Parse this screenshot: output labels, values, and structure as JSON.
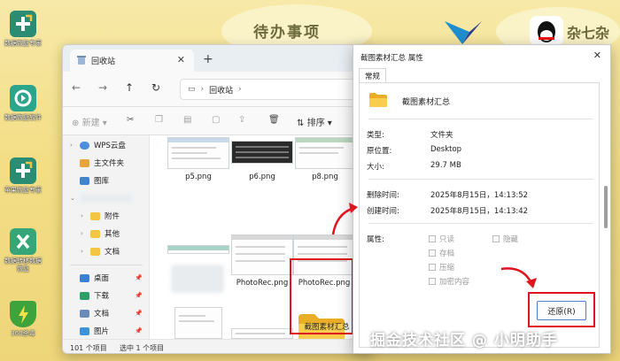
{
  "desktop": {
    "banner_title": "待办事项",
    "banner_title_right": "杂七杂",
    "icons": [
      {
        "label": "数据恢复专家",
        "color": "#2a8c73"
      },
      {
        "label": "数据恢复软件",
        "color": "#2ca58d"
      },
      {
        "label": "苹果恢复专家",
        "color": "#2a8c73"
      },
      {
        "label": "数据转移数据恢复",
        "color": "#36a678"
      },
      {
        "label": "360杀毒",
        "color": "#3da33a"
      }
    ]
  },
  "explorer": {
    "tab_title": "回收站",
    "address": "回收站",
    "commands": {
      "new": "新建",
      "sort": "排序"
    },
    "nav": {
      "wps": "WPS云盘",
      "home": "主文件夹",
      "gallery": "图库",
      "attachments": "附件",
      "misc": "其他",
      "docs": "文档",
      "desktop": "桌面",
      "downloads": "下载",
      "documents": "文档",
      "pictures": "图片"
    },
    "files": [
      "p5.png",
      "p6.png",
      "p8.png",
      "PhotoRec.png",
      "PhotoRec.png",
      "截图素材汇总"
    ],
    "status": {
      "count": "101 个项目",
      "selected": "选中 1 个项目"
    }
  },
  "dialog": {
    "title": "截图素材汇总 属性",
    "tab": "常规",
    "name": "截图素材汇总",
    "rows": [
      {
        "label": "类型:",
        "value": "文件夹"
      },
      {
        "label": "原位置:",
        "value": "Desktop"
      },
      {
        "label": "大小:",
        "value": "29.7 MB"
      },
      {
        "label": "删除时间:",
        "value": "2025年8月15日，14:13:52"
      },
      {
        "label": "创建时间:",
        "value": "2025年8月15日，14:13:42"
      }
    ],
    "attributes_label": "属性:",
    "attributes": [
      "只读",
      "隐藏",
      "存档",
      "压缩",
      "加密内容"
    ],
    "restore": "还原(R)"
  },
  "watermark": "掘金技术社区 @ 小明助手",
  "colors": {
    "highlight": "#e0141e",
    "accent": "#4d7fd3",
    "folder": "#f4c542"
  }
}
